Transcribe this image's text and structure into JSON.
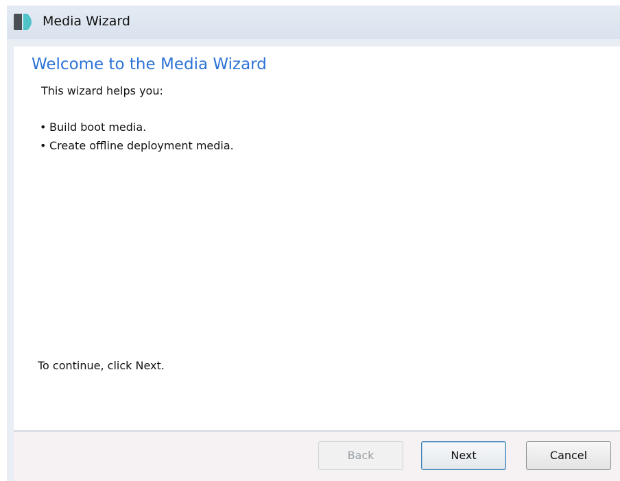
{
  "window": {
    "title": "Media Wizard",
    "icon": "media-wizard-app-icon"
  },
  "page": {
    "heading": "Welcome to the Media Wizard",
    "intro": "This wizard helps you:",
    "bullets": [
      "Build boot media.",
      "Create offline deployment media."
    ],
    "continue_text": "To continue, click Next."
  },
  "buttons": {
    "back": {
      "label": "Back",
      "enabled": false
    },
    "next": {
      "label": "Next",
      "enabled": true,
      "default": true
    },
    "cancel": {
      "label": "Cancel",
      "enabled": true
    }
  },
  "colors": {
    "heading": "#2c73d6",
    "titlebar": "#dde5ef",
    "footer": "#f6f1f3",
    "default_button_border": "#3c7fb1"
  }
}
